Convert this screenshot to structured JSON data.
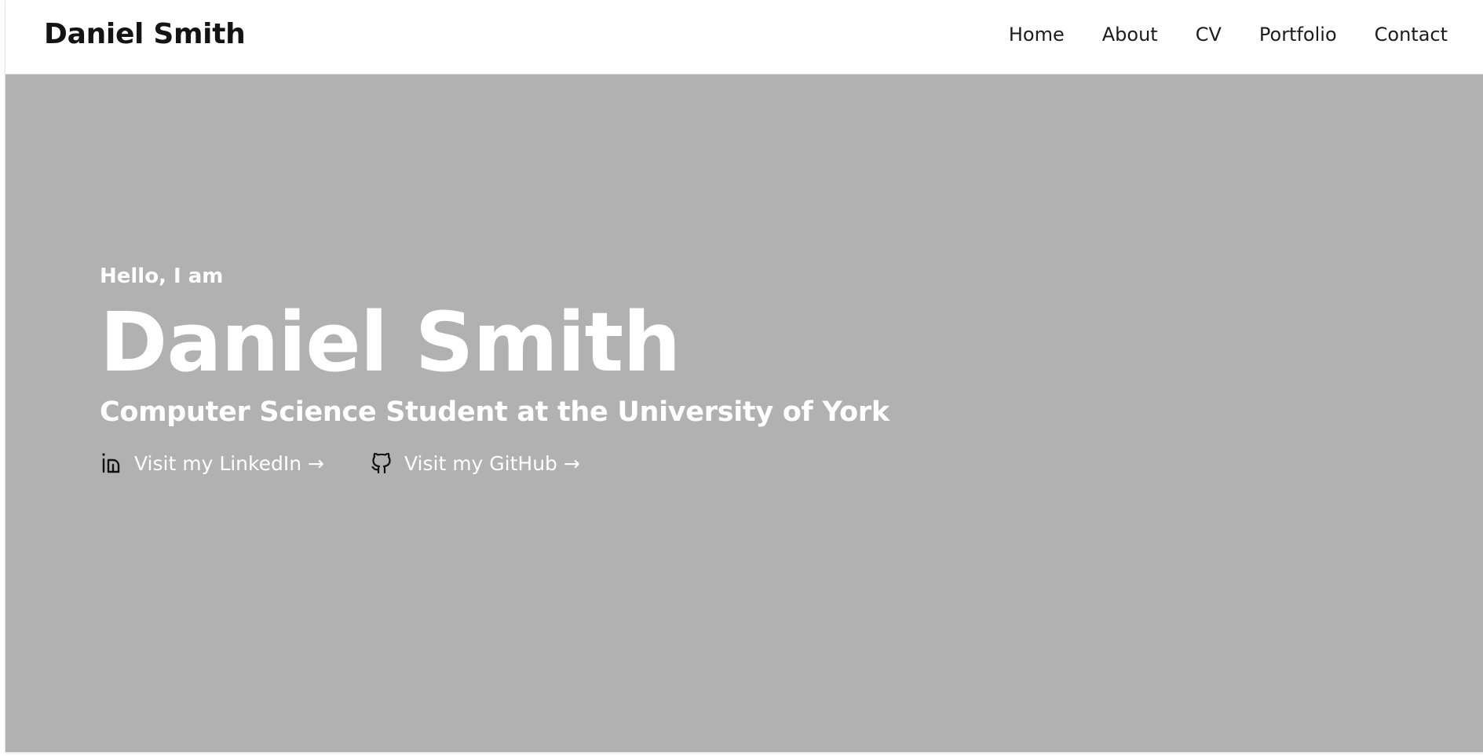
{
  "navbar": {
    "brand": "Daniel Smith",
    "items": [
      {
        "label": "Home"
      },
      {
        "label": "About"
      },
      {
        "label": "CV"
      },
      {
        "label": "Portfolio"
      },
      {
        "label": "Contact"
      }
    ]
  },
  "hero": {
    "greeting": "Hello, I am",
    "name": "Daniel Smith",
    "subtitle": "Computer Science Student at the University of York",
    "links": [
      {
        "icon": "linkedin-icon",
        "label": "Visit my LinkedIn →"
      },
      {
        "icon": "github-icon",
        "label": "Visit my GitHub →"
      }
    ],
    "background_color": "#b1b1b1"
  }
}
